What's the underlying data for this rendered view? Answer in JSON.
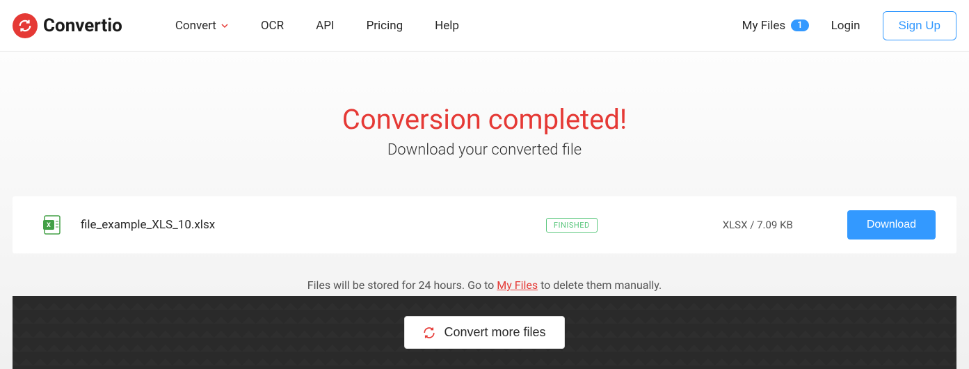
{
  "header": {
    "logo_text": "Convertio",
    "nav": {
      "convert": "Convert",
      "ocr": "OCR",
      "api": "API",
      "pricing": "Pricing",
      "help": "Help"
    },
    "my_files": "My Files",
    "my_files_count": "1",
    "login": "Login",
    "signup": "Sign Up"
  },
  "main": {
    "title": "Conversion completed!",
    "subtitle": "Download your converted file",
    "file": {
      "name": "file_example_XLS_10.xlsx",
      "status": "FINISHED",
      "meta": "XLSX / 7.09 KB",
      "download_label": "Download"
    },
    "info_prefix": "Files will be stored for 24 hours. Go to ",
    "info_link": "My Files",
    "info_suffix": " to delete them manually.",
    "convert_more": "Convert more files"
  }
}
